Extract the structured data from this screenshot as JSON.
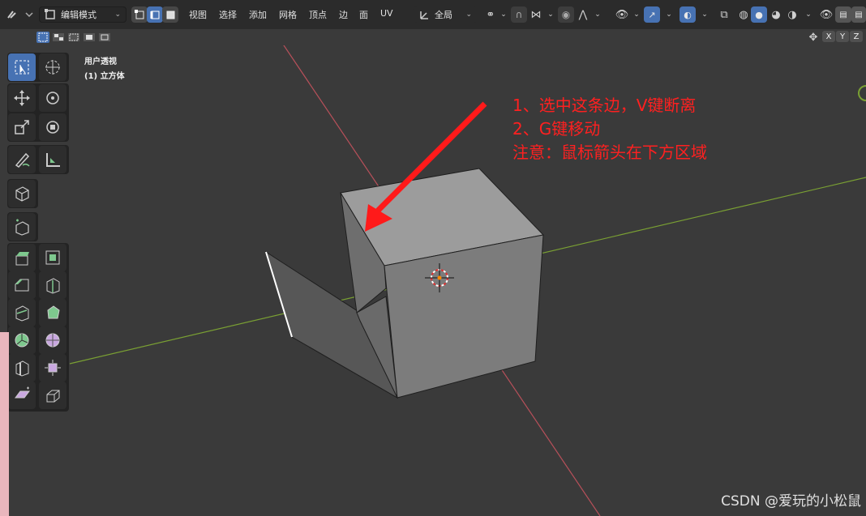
{
  "header": {
    "mode_label": "编辑模式",
    "menus": [
      "视图",
      "选择",
      "添加",
      "网格",
      "顶点",
      "边",
      "面",
      "UV"
    ],
    "transform_orientation": "全局",
    "select_mode": {
      "vertex": false,
      "edge": true,
      "face": false
    },
    "axis_buttons": [
      "X",
      "Y",
      "Z"
    ]
  },
  "viewport": {
    "view_name": "用户透视",
    "object_name": "(1) 立方体",
    "background": "#3a3a3a",
    "x_axis_color": "#b8505a",
    "y_axis_color": "#7aa033"
  },
  "annotation": {
    "lines": [
      "1、选中这条边，V键断离",
      "2、G键移动",
      "注意：鼠标箭头在下方区域"
    ],
    "color": "#ff2020"
  },
  "watermark": "CSDN @爱玩的小松鼠",
  "icons": {
    "tools": [
      "select-box-icon",
      "cursor-icon",
      "move-icon",
      "rotate-icon",
      "scale-icon",
      "transform-icon",
      "annotate-icon",
      "measure-icon",
      "add-cube-icon",
      "extrude-region-icon",
      "inset-faces-icon",
      "bevel-icon",
      "loop-cut-icon",
      "knife-icon",
      "poly-build-icon",
      "spin-icon",
      "smooth-icon",
      "edge-slide-icon",
      "shrink-fatten-icon",
      "shear-icon",
      "rip-region-icon"
    ]
  }
}
